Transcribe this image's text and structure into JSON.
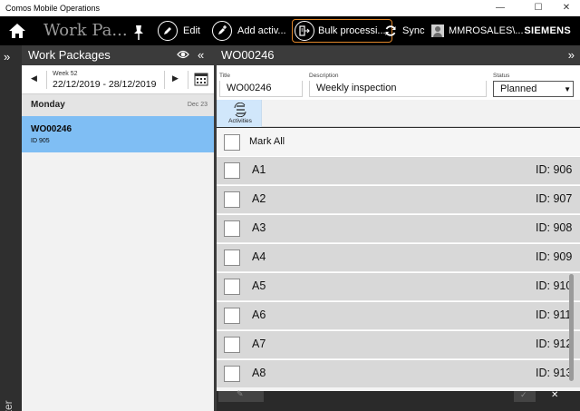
{
  "window": {
    "title": "Comos Mobile Operations",
    "minimize": "—",
    "maximize": "☐",
    "close": "✕"
  },
  "toolbar": {
    "app_title": "Work Pa...",
    "edit_label": "Edit",
    "add_activity_label": "Add activ...",
    "bulk_label": "Bulk processi...",
    "sync_label": "Sync",
    "user_label": "MMROSALES\\...",
    "brand": "SIEMENS",
    "icons": [
      "home-icon",
      "pin-icon",
      "pencil-icon",
      "add-activity-icon",
      "bulk-processing-icon",
      "sync-icon",
      "user-avatar-icon"
    ]
  },
  "filter": {
    "expand_glyph": "»",
    "label": "Filter"
  },
  "work_packages": {
    "header": "Work Packages",
    "collapse_glyph": "«",
    "week_label": "Week 52",
    "week_range": "22/12/2019 - 28/12/2019",
    "prev_glyph": "◀",
    "next_glyph": "▶",
    "day": "Monday",
    "day_date": "Dec 23",
    "items": [
      {
        "name": "WO00246",
        "id": "ID 905"
      }
    ]
  },
  "detail": {
    "header": "WO00246",
    "expand_glyph": "»",
    "title_label": "Title",
    "title_value": "WO00246",
    "description_label": "Description",
    "description_value": "Weekly inspection",
    "status_label": "Status",
    "status_value": "Planned",
    "status_arrow": "▼",
    "tab_activities": "Activities",
    "mark_all": "Mark All",
    "activities": [
      {
        "name": "A1",
        "id": "ID: 906"
      },
      {
        "name": "A2",
        "id": "ID: 907"
      },
      {
        "name": "A3",
        "id": "ID: 908"
      },
      {
        "name": "A4",
        "id": "ID: 909"
      },
      {
        "name": "A5",
        "id": "ID: 910"
      },
      {
        "name": "A6",
        "id": "ID: 911"
      },
      {
        "name": "A7",
        "id": "ID: 912"
      },
      {
        "name": "A8",
        "id": "ID: 913"
      }
    ],
    "bottom_pencil_glyph": "✎",
    "bottom_check_glyph": "✓",
    "bottom_close_glyph": "✕"
  },
  "colors": {
    "toolbar_bg": "#000000",
    "pane_header_bg": "#3b3b3b",
    "selected_item": "#7fbef4",
    "bulk_outline": "#e0862a",
    "activity_row": "#d8d8d8",
    "tab_selected": "#d1e7fb"
  }
}
